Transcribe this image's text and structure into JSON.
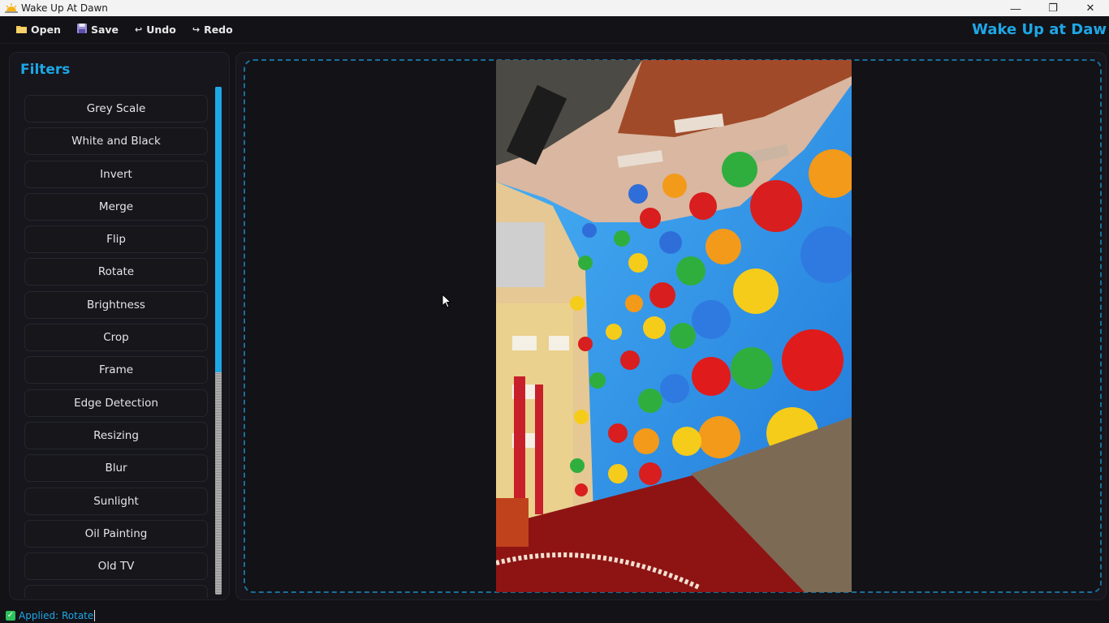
{
  "window": {
    "title": "Wake Up At Dawn",
    "minimize_glyph": "—",
    "maximize_glyph": "❐",
    "close_glyph": "✕"
  },
  "toolbar": {
    "open_label": "Open",
    "save_label": "Save",
    "undo_label": "Undo",
    "redo_label": "Redo",
    "brand": "Wake Up at Daw"
  },
  "sidebar": {
    "title": "Filters",
    "filters": [
      "Grey Scale",
      "White and Black",
      "Invert",
      "Merge",
      "Flip",
      "Rotate",
      "Brightness",
      "Crop",
      "Frame",
      "Edge Detection",
      "Resizing",
      "Blur",
      "Sunlight",
      "Oil Painting",
      "Old TV",
      ""
    ]
  },
  "status": {
    "text": "Applied: Rotate"
  },
  "colors": {
    "accent": "#1ea7e6",
    "background": "#121217",
    "panel": "#16161c",
    "status_ok": "#2ec05a"
  },
  "icons": {
    "app": "sunrise-icon",
    "open": "folder-icon",
    "save": "floppy-disk-icon",
    "undo": "undo-arrow-icon",
    "redo": "redo-arrow-icon"
  }
}
